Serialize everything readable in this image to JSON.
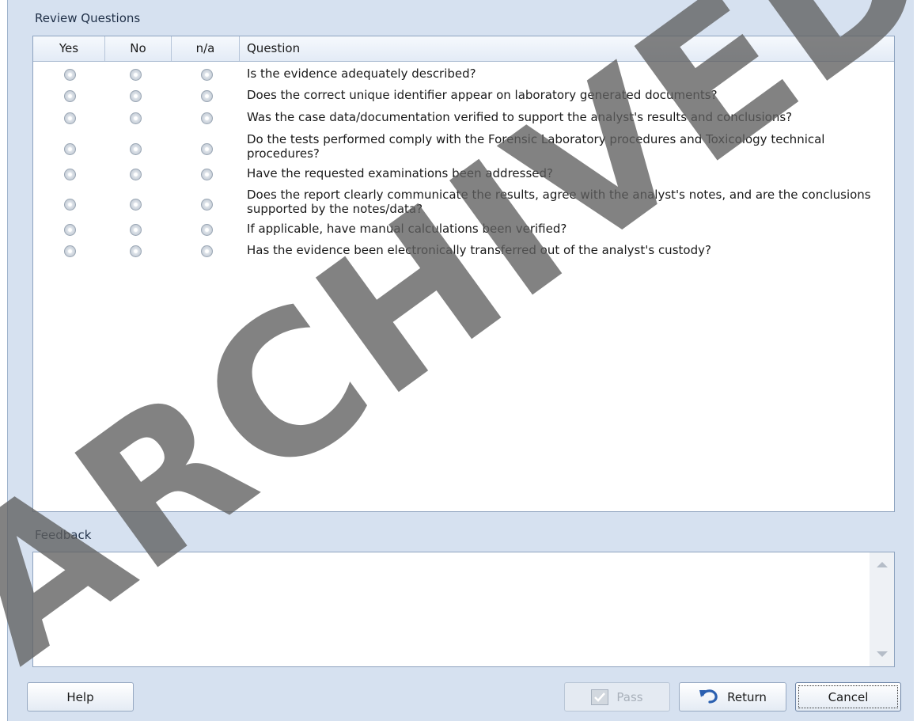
{
  "review_questions": {
    "title": "Review Questions",
    "columns": {
      "yes": "Yes",
      "no": "No",
      "na": "n/a",
      "question": "Question"
    },
    "rows": [
      {
        "question": "Is the evidence adequately described?"
      },
      {
        "question": "Does the correct unique identifier appear on laboratory generated documents?"
      },
      {
        "question": "Was the case data/documentation verified to support the analyst's results and conclusions?"
      },
      {
        "question": "Do the tests performed comply with the Forensic Laboratory procedures and Toxicology technical procedures?"
      },
      {
        "question": "Have the requested examinations been addressed?"
      },
      {
        "question": "Does the report clearly communicate the results, agree with the analyst's notes, and are the conclusions supported by the notes/data?"
      },
      {
        "question": "If applicable, have manual calculations been verified?"
      },
      {
        "question": "Has the evidence been electronically transferred out of the analyst's custody?"
      }
    ]
  },
  "feedback": {
    "title": "Feedback",
    "value": ""
  },
  "buttons": {
    "help": "Help",
    "pass": "Pass",
    "return": "Return",
    "cancel": "Cancel"
  },
  "watermark": "ARCHIVED",
  "icons": {
    "pass": "checkbox-icon",
    "return": "undo-arrow-icon"
  },
  "colors": {
    "background": "#d6e1f0",
    "border": "#8ea3bf",
    "return_icon": "#2a5fb0"
  }
}
